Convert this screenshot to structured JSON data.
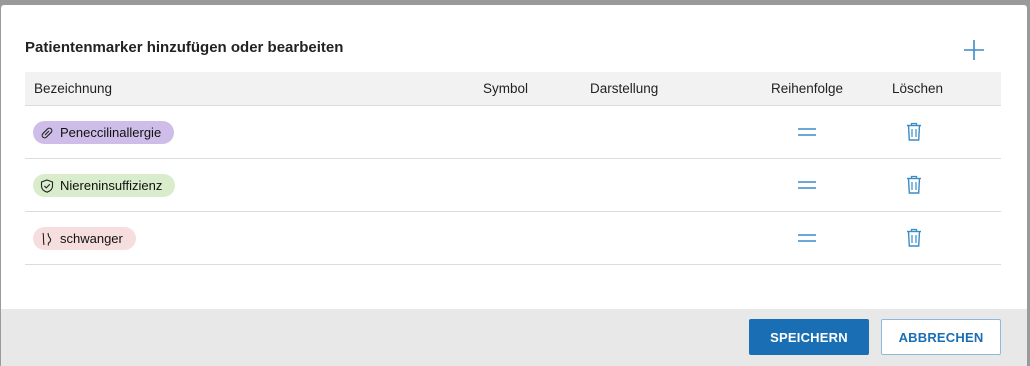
{
  "dialog": {
    "title": "Patientenmarker hinzufügen oder bearbeiten"
  },
  "table": {
    "headers": {
      "name": "Bezeichnung",
      "symbol": "Symbol",
      "display": "Darstellung",
      "order": "Reihenfolge",
      "delete": "Löschen"
    },
    "rows": [
      {
        "label": "Peneccilinallergie",
        "icon": "pill-icon",
        "color": "#cdbde8"
      },
      {
        "label": "Niereninsuffizienz",
        "icon": "shield-check-icon",
        "color": "#d9eccc"
      },
      {
        "label": "schwanger",
        "icon": "pregnant-icon",
        "color": "#f7dede"
      }
    ]
  },
  "footer": {
    "save_label": "SPEICHERN",
    "cancel_label": "ABBRECHEN"
  },
  "colors": {
    "accent": "#1a6fb4",
    "icon": "#3a8cc8"
  }
}
